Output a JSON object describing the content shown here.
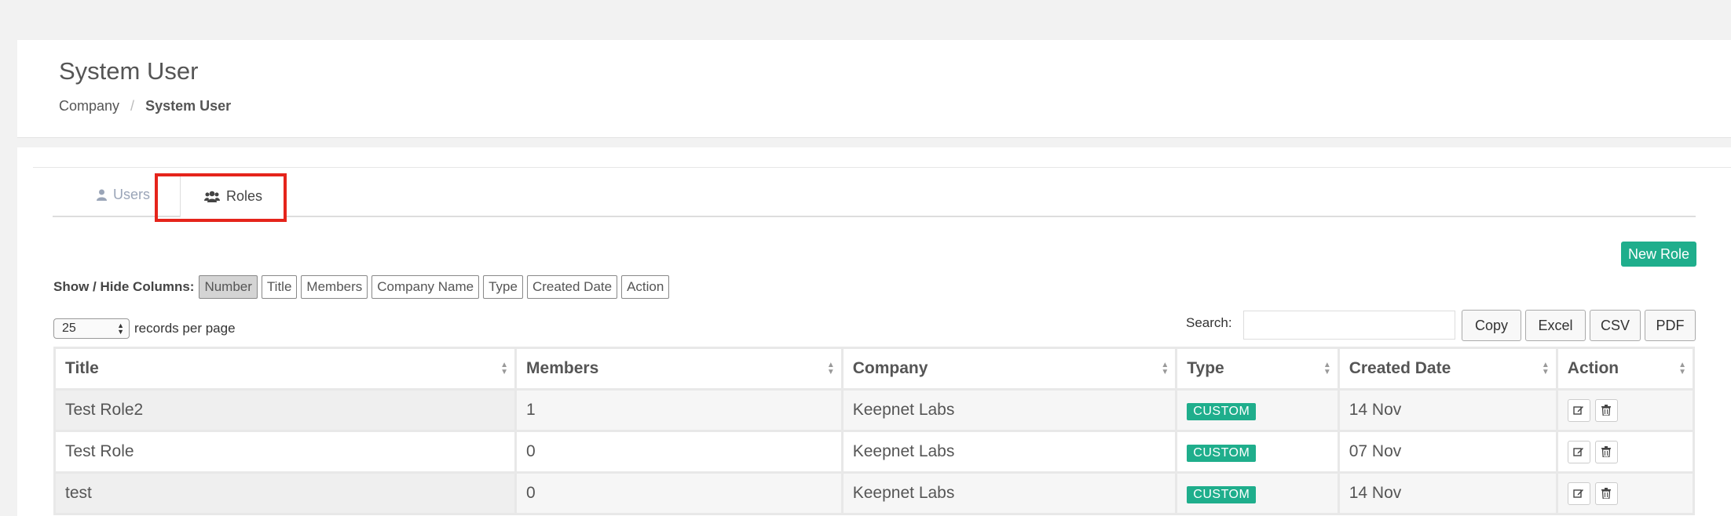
{
  "header": {
    "title": "System User",
    "breadcrumb": {
      "parent": "Company",
      "separator": "/",
      "current": "System User"
    }
  },
  "tabs": [
    {
      "label": "Users",
      "icon": "user-icon",
      "active": false
    },
    {
      "label": "Roles",
      "icon": "users-icon",
      "active": true
    }
  ],
  "toolbar": {
    "new_role": "New Role",
    "show_hide_label": "Show / Hide Columns:",
    "columns": [
      "Number",
      "Title",
      "Members",
      "Company Name",
      "Type",
      "Created Date",
      "Action"
    ],
    "page_size": "25",
    "records_label": "records per page",
    "search_label": "Search:",
    "search_value": "",
    "export": {
      "copy": "Copy",
      "excel": "Excel",
      "csv": "CSV",
      "pdf": "PDF"
    }
  },
  "table": {
    "headers": [
      "Title",
      "Members",
      "Company",
      "Type",
      "Created Date",
      "Action"
    ],
    "rows": [
      {
        "title": "Test Role2",
        "members": "1",
        "company": "Keepnet Labs",
        "type": "CUSTOM",
        "created": "14 Nov"
      },
      {
        "title": "Test Role",
        "members": "0",
        "company": "Keepnet Labs",
        "type": "CUSTOM",
        "created": "07 Nov"
      },
      {
        "title": "test",
        "members": "0",
        "company": "Keepnet Labs",
        "type": "CUSTOM",
        "created": "14 Nov"
      }
    ]
  },
  "colors": {
    "accent": "#1fae8c",
    "highlight": "#e5241b"
  }
}
